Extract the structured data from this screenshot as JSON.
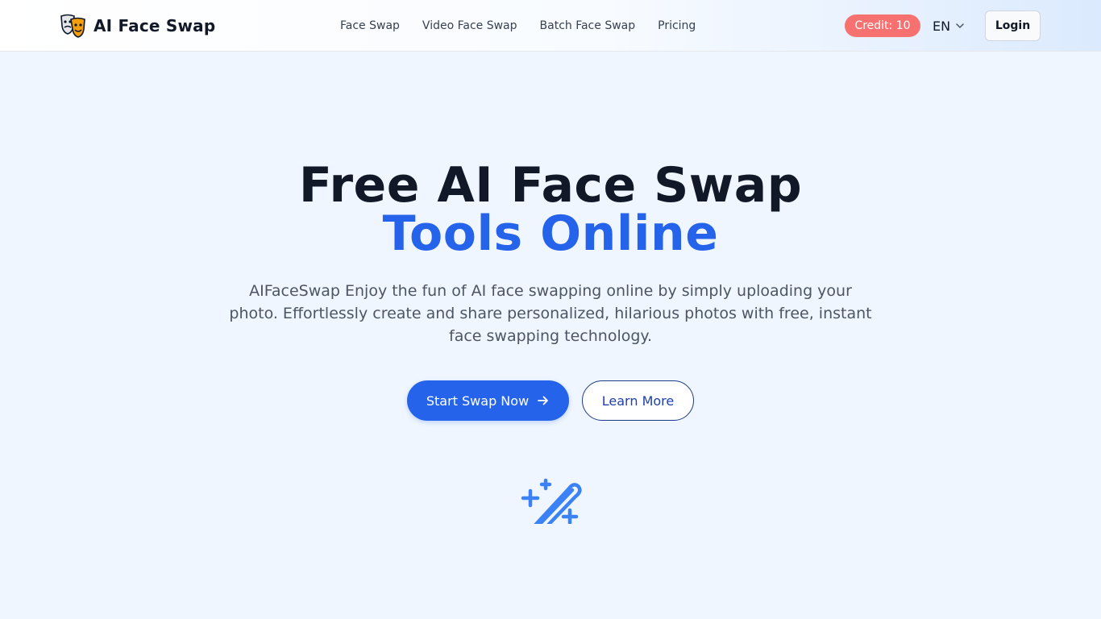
{
  "header": {
    "brand": "AI Face Swap",
    "nav": [
      {
        "label": "Face Swap"
      },
      {
        "label": "Video Face Swap"
      },
      {
        "label": "Batch Face Swap"
      },
      {
        "label": "Pricing"
      }
    ],
    "credit_label": "Credit: 10",
    "language": "EN",
    "login_label": "Login"
  },
  "hero": {
    "title_line1": "Free AI Face Swap",
    "title_line2": "Tools Online",
    "subtitle": "AIFaceSwap Enjoy the fun of AI face swapping online by simply uploading your photo. Effortlessly create and share personalized, hilarious photos with free, instant face swapping technology.",
    "primary_cta": "Start Swap Now",
    "secondary_cta": "Learn More"
  },
  "icons": {
    "logo": "theater-masks-icon",
    "language_caret": "chevron-down-icon",
    "cta_arrow": "arrow-right-icon",
    "hero_graphic": "magic-wand-icon"
  },
  "colors": {
    "accent": "#2563eb",
    "credit_badge": "#f87171",
    "page_background": "#eff6ff",
    "heading": "#111827"
  }
}
